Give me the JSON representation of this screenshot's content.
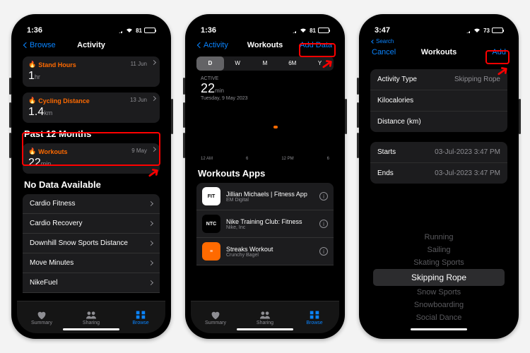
{
  "phone1": {
    "time": "1:36",
    "battery": "81",
    "nav": {
      "back": "Browse",
      "title": "Activity"
    },
    "cards": [
      {
        "icon": "🔥",
        "label": "Stand Hours",
        "date": "11 Jun",
        "value": "1",
        "unit": "hr"
      },
      {
        "icon": "🔥",
        "label": "Cycling Distance",
        "date": "13 Jun",
        "value": "1.4",
        "unit": "km"
      }
    ],
    "section1": "Past 12 Months",
    "workouts_card": {
      "icon": "🔥",
      "label": "Workouts",
      "date": "9 May",
      "value": "22",
      "unit": "min"
    },
    "section2": "No Data Available",
    "rows": [
      "Cardio Fitness",
      "Cardio Recovery",
      "Downhill Snow Sports Distance",
      "Move Minutes",
      "NikeFuel"
    ],
    "tabs": [
      "Summary",
      "Sharing",
      "Browse"
    ]
  },
  "phone2": {
    "time": "1:36",
    "battery": "81",
    "nav": {
      "back": "Activity",
      "title": "Workouts",
      "action": "Add Data"
    },
    "seg": [
      "D",
      "W",
      "M",
      "6M",
      "Y"
    ],
    "chart": {
      "label": "ACTIVE",
      "value": "22",
      "unit": "min",
      "date": "Tuesday, 9 May 2023",
      "axis": [
        "12 AM",
        "6",
        "12 PM",
        "6"
      ]
    },
    "section": "Workouts Apps",
    "apps": [
      {
        "name": "Jillian Michaels | Fitness App",
        "sub": "EM Digital",
        "bg": "#ffffff",
        "fg": "#000",
        "ic": "FIT"
      },
      {
        "name": "Nike Training Club: Fitness",
        "sub": "Nike, Inc",
        "bg": "#000000",
        "fg": "#fff",
        "ic": "NTC"
      },
      {
        "name": "Streaks Workout",
        "sub": "Crunchy Bagel",
        "bg": "#ff6a00",
        "fg": "#fff",
        "ic": "≡"
      }
    ],
    "tabs": [
      "Summary",
      "Sharing",
      "Browse"
    ]
  },
  "phone3": {
    "time": "3:47",
    "battery": "73",
    "search": "Search",
    "nav": {
      "cancel": "Cancel",
      "title": "Workouts",
      "action": "Add"
    },
    "rows": [
      {
        "k": "Activity Type",
        "v": "Skipping Rope"
      },
      {
        "k": "Kilocalories",
        "v": ""
      },
      {
        "k": "Distance (km)",
        "v": ""
      }
    ],
    "rows2": [
      {
        "k": "Starts",
        "v": "03-Jul-2023  3:47 PM"
      },
      {
        "k": "Ends",
        "v": "03-Jul-2023  3:47 PM"
      }
    ],
    "picker": [
      "Running",
      "Sailing",
      "Skating Sports",
      "Skipping Rope",
      "Snow Sports",
      "Snowboarding",
      "Social Dance"
    ]
  }
}
